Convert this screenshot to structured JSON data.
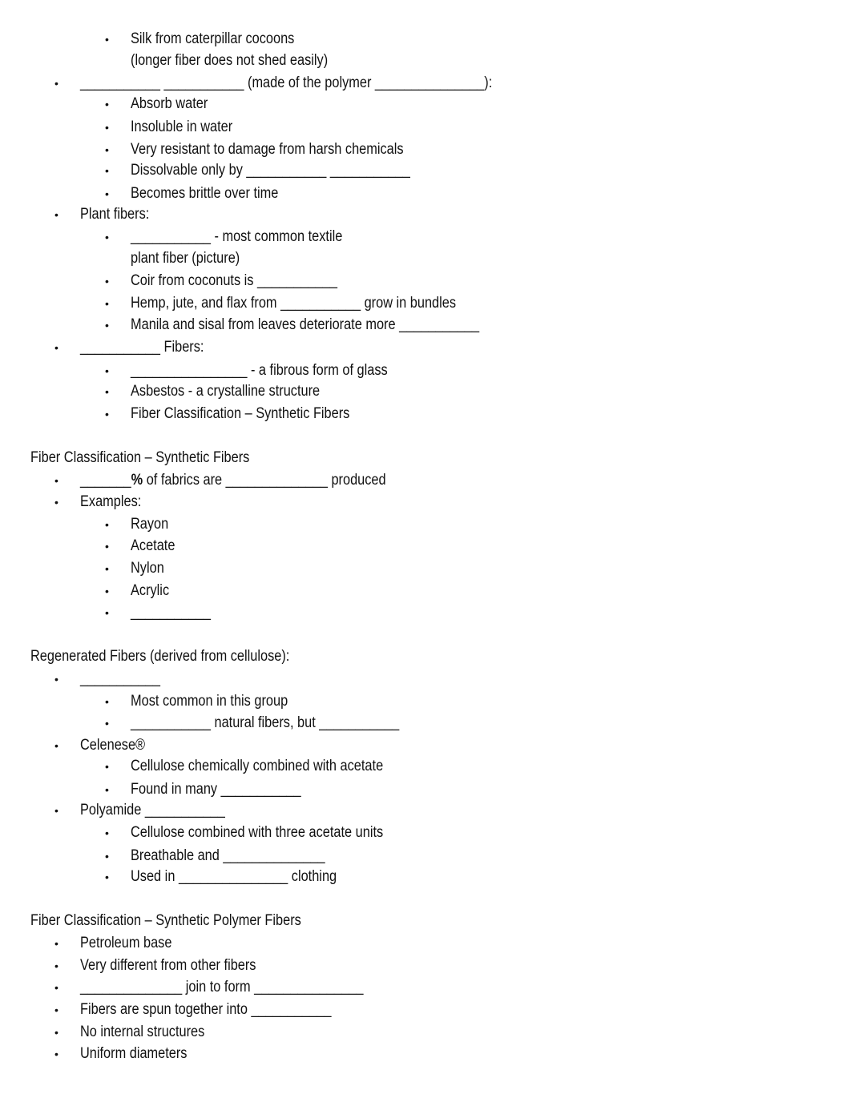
{
  "document": {
    "lines": [
      {
        "level": 2,
        "bullet": true,
        "segments": [
          "Silk from caterpillar cocoons"
        ]
      },
      {
        "level": 2,
        "bullet": false,
        "segments": [
          "(longer fiber does not shed easily)"
        ]
      },
      {
        "level": 1,
        "bullet": true,
        "segments": [
          "___________ ___________ (made of the polymer _______________):"
        ]
      },
      {
        "level": 2,
        "bullet": true,
        "segments": [
          "Absorb water"
        ]
      },
      {
        "level": 2,
        "bullet": true,
        "segments": [
          "Insoluble in water"
        ]
      },
      {
        "level": 2,
        "bullet": true,
        "segments": [
          "Very resistant to damage from harsh chemicals"
        ]
      },
      {
        "level": 2,
        "bullet": true,
        "segments": [
          "Dissolvable only by ___________ ___________"
        ]
      },
      {
        "level": 2,
        "bullet": true,
        "segments": [
          "Becomes brittle over time"
        ]
      },
      {
        "level": 1,
        "bullet": true,
        "segments": [
          "Plant fibers:"
        ]
      },
      {
        "level": 2,
        "bullet": true,
        "segments": [
          "___________ - most common textile"
        ]
      },
      {
        "level": 2,
        "bullet": false,
        "segments": [
          "plant fiber (picture)"
        ]
      },
      {
        "level": 2,
        "bullet": true,
        "segments": [
          "Coir from coconuts is ___________"
        ]
      },
      {
        "level": 2,
        "bullet": true,
        "segments": [
          "Hemp, jute, and flax from ___________ grow in bundles"
        ]
      },
      {
        "level": 2,
        "bullet": true,
        "segments": [
          "Manila and sisal from leaves deteriorate more ___________"
        ]
      },
      {
        "level": 1,
        "bullet": true,
        "segments": [
          "___________ Fibers:"
        ]
      },
      {
        "level": 2,
        "bullet": true,
        "segments": [
          "________________ - a fibrous form of glass"
        ]
      },
      {
        "level": 2,
        "bullet": true,
        "segments": [
          "Asbestos - a crystalline structure"
        ]
      },
      {
        "level": 2,
        "bullet": true,
        "segments": [
          "Fiber Classification – Synthetic Fibers"
        ]
      },
      {
        "level": 0,
        "bullet": false,
        "segments": [
          "Fiber Classification – Synthetic Fibers"
        ]
      },
      {
        "level": 1,
        "bullet": true,
        "segments": [
          "_______",
          "%",
          " of fabrics are ______________ produced"
        ],
        "bold_index": 1
      },
      {
        "level": 1,
        "bullet": true,
        "segments": [
          "Examples:"
        ]
      },
      {
        "level": 2,
        "bullet": true,
        "segments": [
          "Rayon"
        ]
      },
      {
        "level": 2,
        "bullet": true,
        "segments": [
          "Acetate"
        ]
      },
      {
        "level": 2,
        "bullet": true,
        "segments": [
          "Nylon"
        ]
      },
      {
        "level": 2,
        "bullet": true,
        "segments": [
          "Acrylic"
        ]
      },
      {
        "level": 2,
        "bullet": true,
        "segments": [
          "___________"
        ]
      },
      {
        "level": 0,
        "bullet": false,
        "segments": [
          "Regenerated Fibers (derived from cellulose):"
        ]
      },
      {
        "level": 1,
        "bullet": true,
        "segments": [
          "___________"
        ]
      },
      {
        "level": 2,
        "bullet": true,
        "segments": [
          "Most common in this group"
        ]
      },
      {
        "level": 2,
        "bullet": true,
        "segments": [
          "___________ natural fibers, but ___________"
        ]
      },
      {
        "level": 1,
        "bullet": true,
        "segments": [
          "Celenese®"
        ]
      },
      {
        "level": 2,
        "bullet": true,
        "segments": [
          "Cellulose chemically combined with acetate"
        ]
      },
      {
        "level": 2,
        "bullet": true,
        "segments": [
          "Found in many ___________"
        ]
      },
      {
        "level": 1,
        "bullet": true,
        "segments": [
          "Polyamide ___________"
        ]
      },
      {
        "level": 2,
        "bullet": true,
        "segments": [
          "Cellulose combined with three acetate units"
        ]
      },
      {
        "level": 2,
        "bullet": true,
        "segments": [
          "Breathable and ______________"
        ]
      },
      {
        "level": 2,
        "bullet": true,
        "segments": [
          "Used in _______________ clothing"
        ]
      },
      {
        "level": 0,
        "bullet": false,
        "segments": [
          "Fiber Classification – Synthetic Polymer Fibers"
        ]
      },
      {
        "level": 1,
        "bullet": true,
        "segments": [
          "Petroleum base"
        ]
      },
      {
        "level": 1,
        "bullet": true,
        "segments": [
          "Very different from other fibers"
        ]
      },
      {
        "level": 1,
        "bullet": true,
        "segments": [
          "______________ join to form _______________"
        ]
      },
      {
        "level": 1,
        "bullet": true,
        "segments": [
          "Fibers are spun together into ___________"
        ]
      },
      {
        "level": 1,
        "bullet": true,
        "segments": [
          "No internal structures"
        ]
      },
      {
        "level": 1,
        "bullet": true,
        "segments": [
          "Uniform diameters"
        ]
      }
    ],
    "bullet_glyph": "•"
  }
}
